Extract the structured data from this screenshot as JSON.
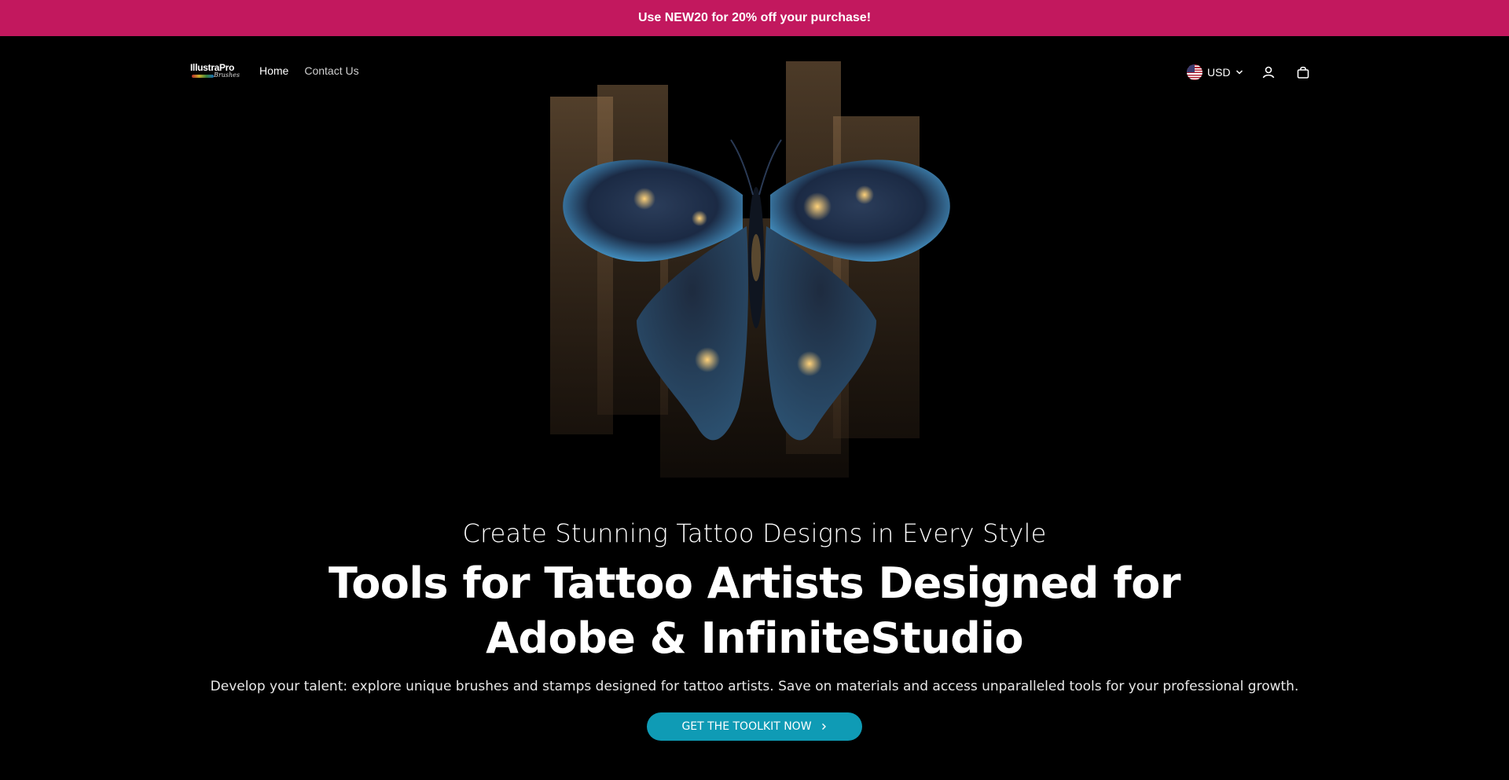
{
  "announcement": {
    "text": "Use NEW20 for 20% off your purchase!"
  },
  "header": {
    "logo_text": "IllustraPro",
    "logo_subtext": "Brushes",
    "nav": [
      {
        "label": "Home"
      },
      {
        "label": "Contact Us"
      }
    ],
    "currency": "USD",
    "icons": [
      "us-flag-icon",
      "chevron-down-icon",
      "account-icon",
      "cart-icon"
    ]
  },
  "hero": {
    "image": "butterfly-artwork",
    "subtitle": "Create Stunning Tattoo Designs in Every Style",
    "title": "Tools for Tattoo Artists Designed for Adobe & InfiniteStudio",
    "description": "Develop your talent: explore unique brushes and stamps designed for tattoo artists. Save on materials and access unparalleled tools for your professional growth.",
    "cta_label": "GET THE TOOLKIT NOW"
  },
  "colors": {
    "announcement_bg": "#c2185e",
    "page_bg": "#000000",
    "cta_bg": "#0f9bb5"
  }
}
